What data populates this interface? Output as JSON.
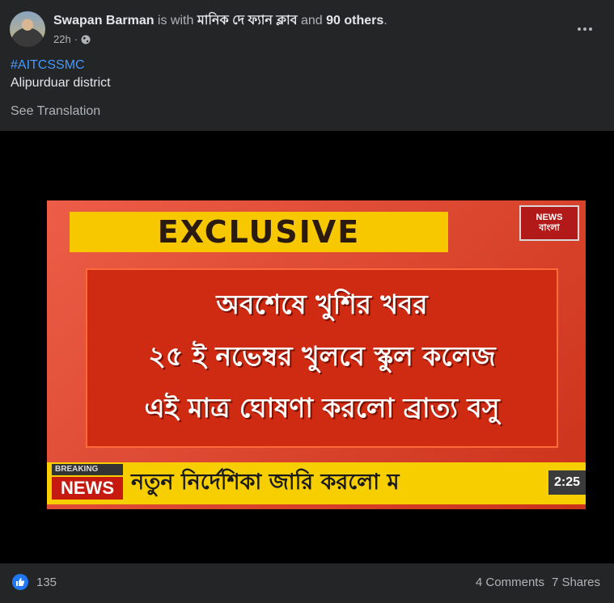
{
  "post": {
    "author": "Swapan Barman",
    "with_text": " is with ",
    "tagged_page": "মানিক দে ফ্যান ক্লাব",
    "and_text": " and ",
    "others": "90 others",
    "period": ".",
    "time": "22h",
    "privacy_icon": "globe-icon",
    "hashtag": "#AITCSSMC",
    "text": "Alipurduar district",
    "translate_label": "See Translation"
  },
  "image": {
    "exclusive": "EXCLUSIVE",
    "logo_line1": "NEWS",
    "logo_line2": "বাংলা",
    "headline_lines": [
      "অবশেষে খুশির খবর",
      "২৫ ই নভেম্বর খুলবে স্কুল কলেজ",
      "এই মাত্র ঘোষণা করলো ব্রাত্য বসু"
    ],
    "breaking_label": "BREAKING",
    "news_label": "NEWS",
    "ticker": "নতুন নির্দেশিকা জারি করলো ম",
    "clock": "2:25"
  },
  "footer": {
    "like_icon": "thumbs-up-icon",
    "like_count": "135",
    "comments": "4 Comments",
    "shares": "7 Shares"
  },
  "colors": {
    "background": "#242526",
    "link": "#4599ff",
    "like": "#2078f4"
  }
}
